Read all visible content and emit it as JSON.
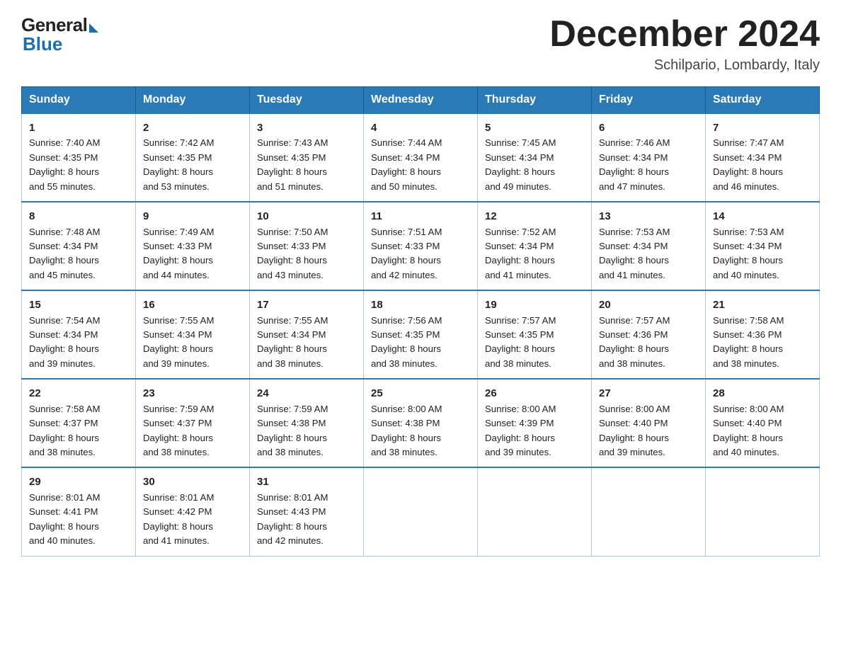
{
  "logo": {
    "general": "General",
    "blue": "Blue"
  },
  "title": "December 2024",
  "location": "Schilpario, Lombardy, Italy",
  "days_header": [
    "Sunday",
    "Monday",
    "Tuesday",
    "Wednesday",
    "Thursday",
    "Friday",
    "Saturday"
  ],
  "weeks": [
    [
      {
        "day": "1",
        "sunrise": "7:40 AM",
        "sunset": "4:35 PM",
        "daylight": "8 hours and 55 minutes."
      },
      {
        "day": "2",
        "sunrise": "7:42 AM",
        "sunset": "4:35 PM",
        "daylight": "8 hours and 53 minutes."
      },
      {
        "day": "3",
        "sunrise": "7:43 AM",
        "sunset": "4:35 PM",
        "daylight": "8 hours and 51 minutes."
      },
      {
        "day": "4",
        "sunrise": "7:44 AM",
        "sunset": "4:34 PM",
        "daylight": "8 hours and 50 minutes."
      },
      {
        "day": "5",
        "sunrise": "7:45 AM",
        "sunset": "4:34 PM",
        "daylight": "8 hours and 49 minutes."
      },
      {
        "day": "6",
        "sunrise": "7:46 AM",
        "sunset": "4:34 PM",
        "daylight": "8 hours and 47 minutes."
      },
      {
        "day": "7",
        "sunrise": "7:47 AM",
        "sunset": "4:34 PM",
        "daylight": "8 hours and 46 minutes."
      }
    ],
    [
      {
        "day": "8",
        "sunrise": "7:48 AM",
        "sunset": "4:34 PM",
        "daylight": "8 hours and 45 minutes."
      },
      {
        "day": "9",
        "sunrise": "7:49 AM",
        "sunset": "4:33 PM",
        "daylight": "8 hours and 44 minutes."
      },
      {
        "day": "10",
        "sunrise": "7:50 AM",
        "sunset": "4:33 PM",
        "daylight": "8 hours and 43 minutes."
      },
      {
        "day": "11",
        "sunrise": "7:51 AM",
        "sunset": "4:33 PM",
        "daylight": "8 hours and 42 minutes."
      },
      {
        "day": "12",
        "sunrise": "7:52 AM",
        "sunset": "4:34 PM",
        "daylight": "8 hours and 41 minutes."
      },
      {
        "day": "13",
        "sunrise": "7:53 AM",
        "sunset": "4:34 PM",
        "daylight": "8 hours and 41 minutes."
      },
      {
        "day": "14",
        "sunrise": "7:53 AM",
        "sunset": "4:34 PM",
        "daylight": "8 hours and 40 minutes."
      }
    ],
    [
      {
        "day": "15",
        "sunrise": "7:54 AM",
        "sunset": "4:34 PM",
        "daylight": "8 hours and 39 minutes."
      },
      {
        "day": "16",
        "sunrise": "7:55 AM",
        "sunset": "4:34 PM",
        "daylight": "8 hours and 39 minutes."
      },
      {
        "day": "17",
        "sunrise": "7:55 AM",
        "sunset": "4:34 PM",
        "daylight": "8 hours and 38 minutes."
      },
      {
        "day": "18",
        "sunrise": "7:56 AM",
        "sunset": "4:35 PM",
        "daylight": "8 hours and 38 minutes."
      },
      {
        "day": "19",
        "sunrise": "7:57 AM",
        "sunset": "4:35 PM",
        "daylight": "8 hours and 38 minutes."
      },
      {
        "day": "20",
        "sunrise": "7:57 AM",
        "sunset": "4:36 PM",
        "daylight": "8 hours and 38 minutes."
      },
      {
        "day": "21",
        "sunrise": "7:58 AM",
        "sunset": "4:36 PM",
        "daylight": "8 hours and 38 minutes."
      }
    ],
    [
      {
        "day": "22",
        "sunrise": "7:58 AM",
        "sunset": "4:37 PM",
        "daylight": "8 hours and 38 minutes."
      },
      {
        "day": "23",
        "sunrise": "7:59 AM",
        "sunset": "4:37 PM",
        "daylight": "8 hours and 38 minutes."
      },
      {
        "day": "24",
        "sunrise": "7:59 AM",
        "sunset": "4:38 PM",
        "daylight": "8 hours and 38 minutes."
      },
      {
        "day": "25",
        "sunrise": "8:00 AM",
        "sunset": "4:38 PM",
        "daylight": "8 hours and 38 minutes."
      },
      {
        "day": "26",
        "sunrise": "8:00 AM",
        "sunset": "4:39 PM",
        "daylight": "8 hours and 39 minutes."
      },
      {
        "day": "27",
        "sunrise": "8:00 AM",
        "sunset": "4:40 PM",
        "daylight": "8 hours and 39 minutes."
      },
      {
        "day": "28",
        "sunrise": "8:00 AM",
        "sunset": "4:40 PM",
        "daylight": "8 hours and 40 minutes."
      }
    ],
    [
      {
        "day": "29",
        "sunrise": "8:01 AM",
        "sunset": "4:41 PM",
        "daylight": "8 hours and 40 minutes."
      },
      {
        "day": "30",
        "sunrise": "8:01 AM",
        "sunset": "4:42 PM",
        "daylight": "8 hours and 41 minutes."
      },
      {
        "day": "31",
        "sunrise": "8:01 AM",
        "sunset": "4:43 PM",
        "daylight": "8 hours and 42 minutes."
      },
      null,
      null,
      null,
      null
    ]
  ],
  "labels": {
    "sunrise": "Sunrise:",
    "sunset": "Sunset:",
    "daylight": "Daylight:"
  }
}
